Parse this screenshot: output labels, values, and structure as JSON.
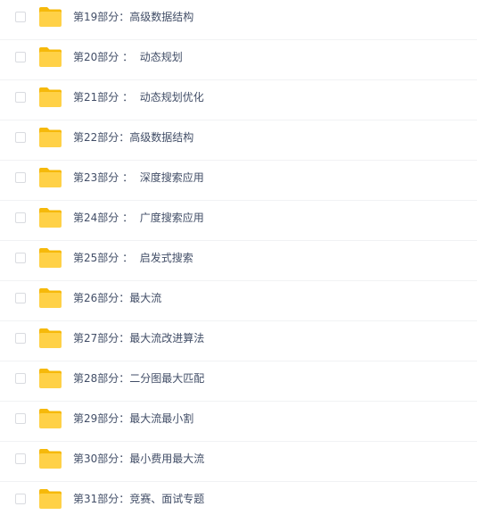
{
  "file_list": {
    "items": [
      {
        "name": "第19部分：高级数据结构"
      },
      {
        "name": "第20部分 ：  动态规划"
      },
      {
        "name": "第21部分 ：  动态规划优化"
      },
      {
        "name": "第22部分：高级数据结构"
      },
      {
        "name": "第23部分 ：  深度搜索应用"
      },
      {
        "name": "第24部分 ：  广度搜索应用"
      },
      {
        "name": "第25部分 ：  启发式搜索"
      },
      {
        "name": "第26部分：最大流"
      },
      {
        "name": "第27部分：最大流改进算法"
      },
      {
        "name": "第28部分：二分图最大匹配"
      },
      {
        "name": "第29部分：最大流最小割"
      },
      {
        "name": "第30部分：最小费用最大流"
      },
      {
        "name": "第31部分：竞赛、面试专题"
      }
    ]
  },
  "colors": {
    "folder_body": "#ffd147",
    "folder_tab": "#f6b90a",
    "text": "#424e67",
    "divider": "#f1f2f4",
    "checkbox_border": "#d9dbe0"
  },
  "icons": {
    "folder": "folder-icon",
    "checkbox": "checkbox-icon"
  }
}
